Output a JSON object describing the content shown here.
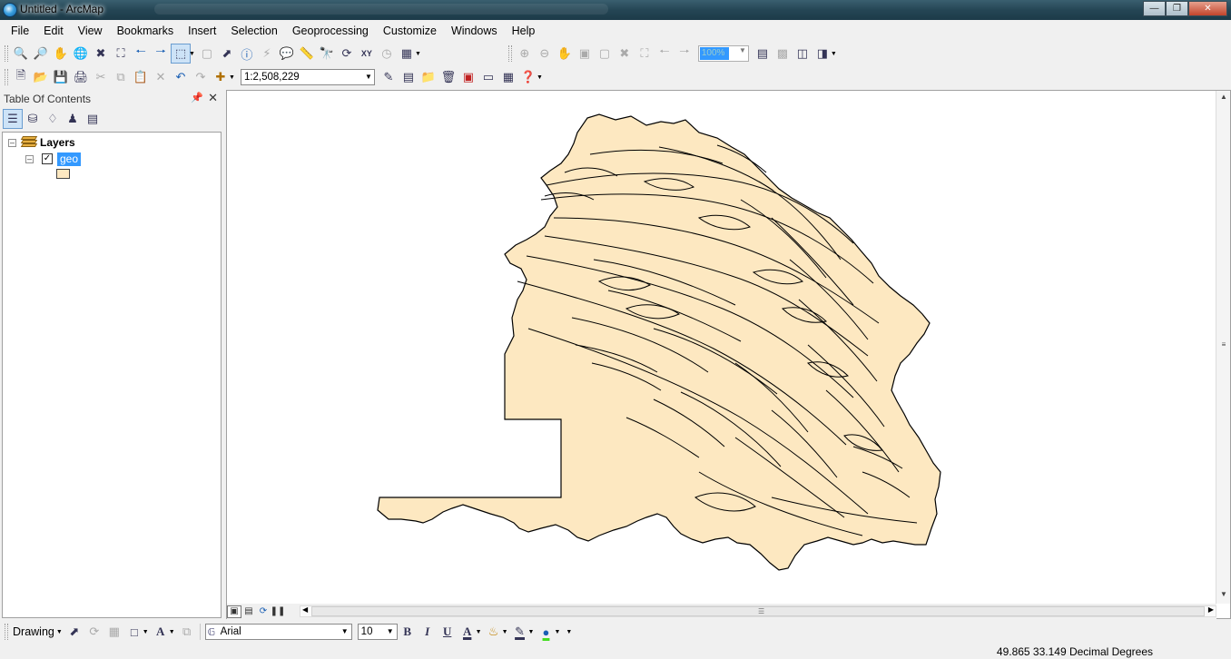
{
  "window": {
    "title": "Untitled - ArcMap",
    "controls": [
      "minimize",
      "maximize",
      "close"
    ]
  },
  "menu": [
    "File",
    "Edit",
    "View",
    "Bookmarks",
    "Insert",
    "Selection",
    "Geoprocessing",
    "Customize",
    "Windows",
    "Help"
  ],
  "standard_toolbar": {
    "scale": "1:2,508,229"
  },
  "layout_toolbar": {
    "zoom_percent": "100%"
  },
  "toc": {
    "title": "Table Of Contents",
    "root_label": "Layers",
    "layer_label": "geo",
    "layer_visible": true,
    "layer_fill": "#fde8c1"
  },
  "map": {
    "fill_color": "#fde8c1",
    "outline_color": "#000000"
  },
  "drawing_toolbar": {
    "label": "Drawing",
    "font": "Arial",
    "font_size": "10",
    "bold": "B",
    "italic": "I",
    "underline": "U",
    "font_color_glyph": "A"
  },
  "status": {
    "coordinates": "49.865  33.149 Decimal Degrees"
  }
}
